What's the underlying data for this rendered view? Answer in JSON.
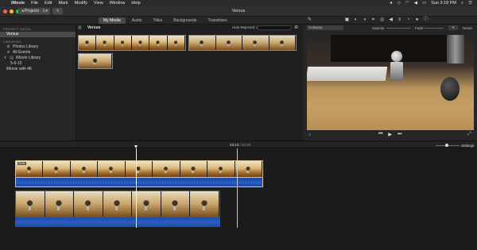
{
  "menubar": {
    "app": "iMovie",
    "items": [
      "File",
      "Edit",
      "Mark",
      "Modify",
      "View",
      "Window",
      "Help"
    ],
    "clock": "Sun 3:18 PM"
  },
  "toolbar": {
    "projects_label": "◂ Projects",
    "window_title": "Versus"
  },
  "browser_tabs": [
    "My Media",
    "Audio",
    "Titles",
    "Backgrounds",
    "Transitions"
  ],
  "sidebar": {
    "project_media_head": "PROJECT MEDIA",
    "project_item": "Versus",
    "libraries_head": "LIBRARIES",
    "libraries": [
      {
        "label": "Photos Library",
        "icon": "photos-icon"
      },
      {
        "label": "All Events",
        "icon": "star-icon"
      },
      {
        "label": "iMovie Library",
        "icon": "film-icon"
      },
      {
        "label": "5-6-15",
        "icon": "event-icon"
      },
      {
        "label": "iMovie with 4K",
        "icon": "event-icon"
      }
    ]
  },
  "browser": {
    "title": "Versus",
    "hide_rejected": "Hide Rejected ◇",
    "clips": [
      {
        "duration": "",
        "frames": 6
      },
      {
        "duration": "26.5s",
        "frames": 4
      },
      {
        "duration": "",
        "frames": 1
      }
    ]
  },
  "viewer": {
    "preset": "Cutaway",
    "opacity_label": "Opacity:",
    "fade_label": "Fade:",
    "fade_value": "0",
    "reset_label": "Reset"
  },
  "timeline": {
    "current_time": "03:13",
    "total_time": "/ 50:20",
    "settings_label": "Settings",
    "main_clip_duration": "26.6s",
    "cutaway_clip_duration": ""
  }
}
